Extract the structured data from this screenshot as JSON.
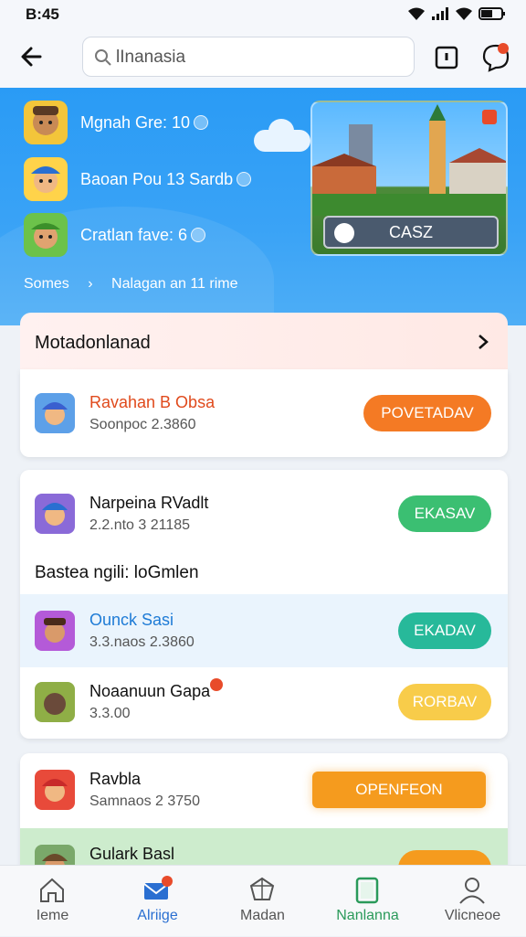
{
  "status_bar": {
    "time": "B:45"
  },
  "search": {
    "query": "lInanasia"
  },
  "hero": {
    "rows": [
      {
        "text": "Mgnah Gre: 10"
      },
      {
        "text": "Baoan Pou 13 Sardb"
      },
      {
        "text": "Cratlan fave: 6"
      }
    ],
    "banner_button": "CASZ",
    "breadcrumb": {
      "home": "Somes",
      "current": "Nalagan an 11 rime"
    }
  },
  "section": {
    "title": "Motadonlanad"
  },
  "cards": [
    {
      "items": [
        {
          "name": "Ravahan B Obsa",
          "sub": "Soonpoc 2.3860",
          "button": "POVETADAV",
          "button_color": "#f47a24",
          "name_color": "#e04a1c"
        }
      ]
    },
    {
      "items": [
        {
          "name": "Narpeina RVadlt",
          "sub": "2.2.nto 3 21185",
          "button": "EKASAV",
          "button_color": "#3bbf72",
          "name_color": "#111111"
        }
      ],
      "subheading": "Bastea ngili: loGmlen",
      "items2": [
        {
          "name": "Ounck Sasi",
          "sub": "3.3.naos 2.3860",
          "button": "EKADAV",
          "button_color": "#27b99a",
          "name_color": "#1e7bd6"
        },
        {
          "name": "Noaanuun Gapa",
          "sub": "3.3.00",
          "button": "RORBAV",
          "button_color": "#f8cc4a",
          "name_color": "#111111"
        }
      ]
    },
    {
      "items": [
        {
          "name": "Ravbla",
          "sub": "Samnaos 2 3750",
          "button": "OPENFEON",
          "button_color": "#f59b1e",
          "name_color": "#111111"
        },
        {
          "name": "Gulark Basl",
          "sub": "",
          "button": "",
          "button_color": "#f59b1e",
          "name_color": "#111111"
        }
      ]
    }
  ],
  "nav": [
    {
      "label": "Ieme",
      "icon": "home-icon",
      "active": false
    },
    {
      "label": "Alriige",
      "icon": "mail-icon",
      "active": true
    },
    {
      "label": "Madan",
      "icon": "puzzle-icon",
      "active": false
    },
    {
      "label": "Nanlanna",
      "icon": "book-icon",
      "active": false
    },
    {
      "label": "Vlicneoe",
      "icon": "person-icon",
      "active": false
    }
  ]
}
